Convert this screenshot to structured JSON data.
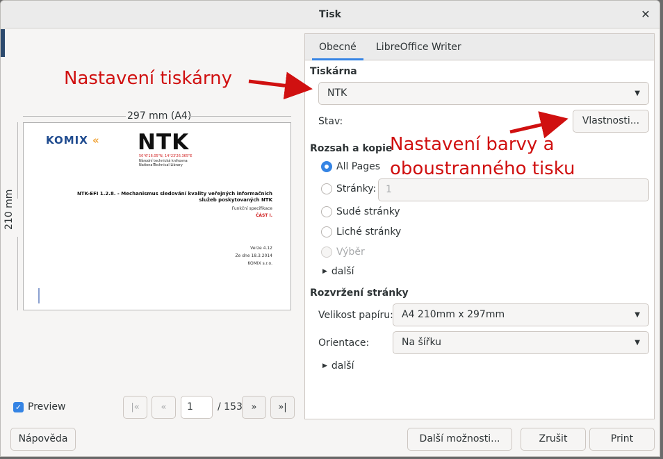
{
  "window": {
    "title": "Tisk",
    "close_icon": "✕"
  },
  "preview": {
    "width_label": "297 mm (A4)",
    "height_label": "210 mm",
    "page": {
      "komix_logo": "KOMIX",
      "ntk_logo": "NTK",
      "ntk_coords": "50°6'16.05\"N, 14°23'26.365\"E",
      "ntk_sub1": "Národní technická knihovna",
      "ntk_sub2": "NationalTechnical Library",
      "title": "NTK-EFI 1.2.8. - Mechanismus sledování kvality veřejných informačních služeb poskytovaných NTK",
      "subtitle": "Funkční specifikace",
      "part": "ČÁST I.",
      "version": "Verze 4.12",
      "date": "Ze dne 18.3.2014",
      "company": "KOMIX s.r.o."
    },
    "checkbox_label": "Preview",
    "checkbox_checked": true,
    "nav": {
      "current_page": "1",
      "total": "/ 153"
    }
  },
  "tabs": [
    {
      "label": "Obecné",
      "active": true
    },
    {
      "label": "LibreOffice Writer",
      "active": false
    }
  ],
  "printer": {
    "section": "Tiskárna",
    "selected": "NTK",
    "status_label": "Stav:",
    "properties_button": "Vlastnosti..."
  },
  "range": {
    "section": "Rozsah a kopie",
    "options": {
      "all": "All Pages",
      "pages": "Stránky:",
      "even": "Sudé stránky",
      "odd": "Liché stránky",
      "selection": "Výběr"
    },
    "pages_value": "1",
    "more": "další"
  },
  "layout": {
    "section": "Rozvržení stránky",
    "paper_label": "Velikost papíru:",
    "paper_value": "A4 210mm x 297mm",
    "orientation_label": "Orientace:",
    "orientation_value": "Na šířku",
    "more": "další"
  },
  "footer": {
    "help": "Nápověda",
    "more_options": "Další možnosti...",
    "cancel": "Zrušit",
    "print": "Print"
  },
  "annotations": {
    "printer_settings": "Nastavení tiskárny",
    "color_duplex_line1": "Nastavení barvy a",
    "color_duplex_line2": "oboustranného tisku",
    "color": "#d01010"
  }
}
